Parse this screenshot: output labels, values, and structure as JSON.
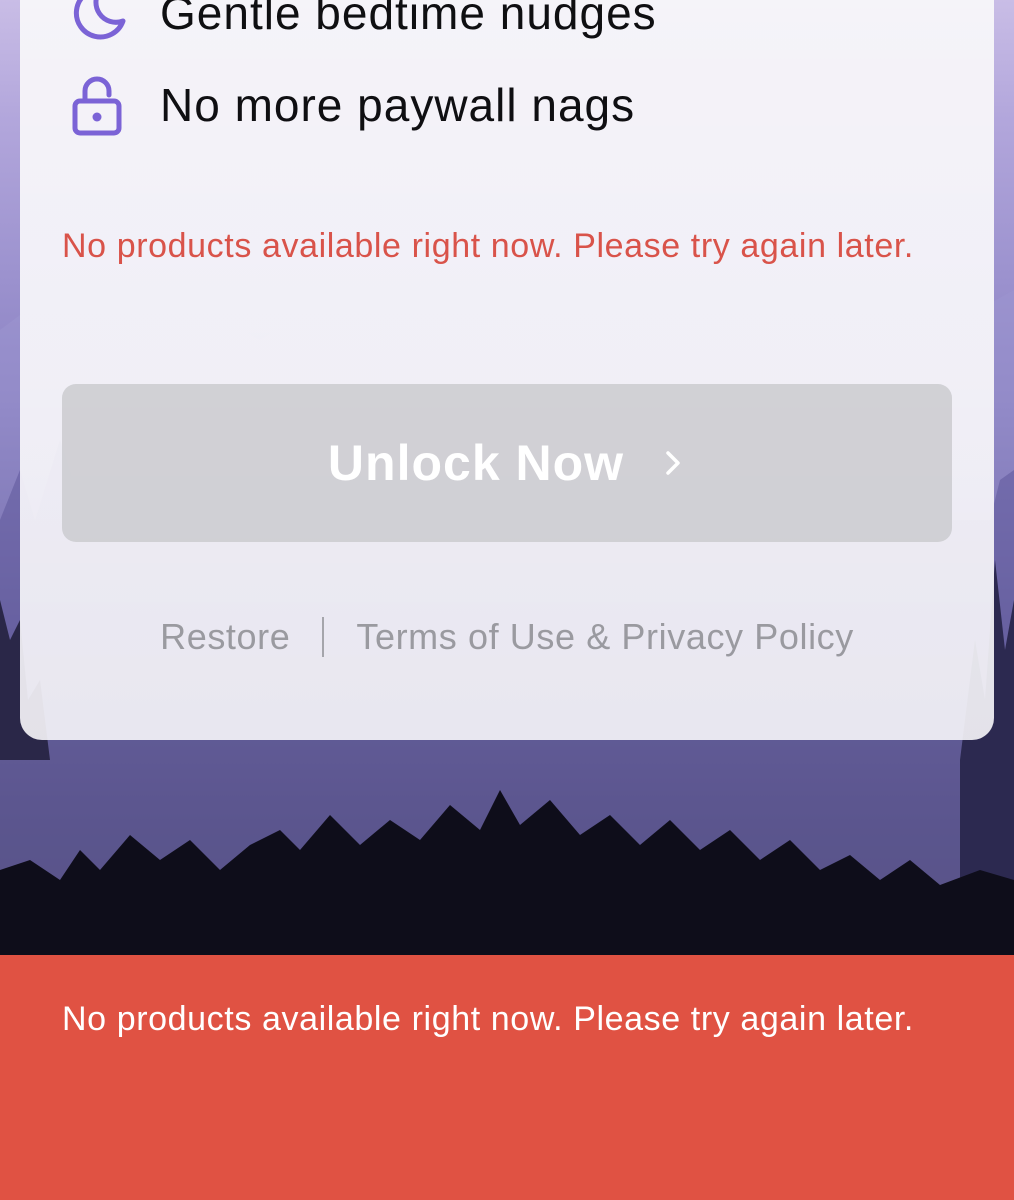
{
  "features": [
    {
      "icon": "moon-icon",
      "label": "Gentle bedtime nudges"
    },
    {
      "icon": "unlock-icon",
      "label": "No more paywall nags"
    }
  ],
  "error_message": "No products available right now. Please try again later.",
  "unlock_button": {
    "label": "Unlock Now"
  },
  "footer_links": {
    "restore": "Restore",
    "terms": "Terms of Use & Privacy Policy"
  },
  "toast": {
    "message": "No products available right now. Please try again later."
  },
  "colors": {
    "accent": "#7b63d6",
    "error_text": "#d9534a",
    "toast_bg": "#e05243",
    "button_disabled": "#c8c8cc"
  }
}
